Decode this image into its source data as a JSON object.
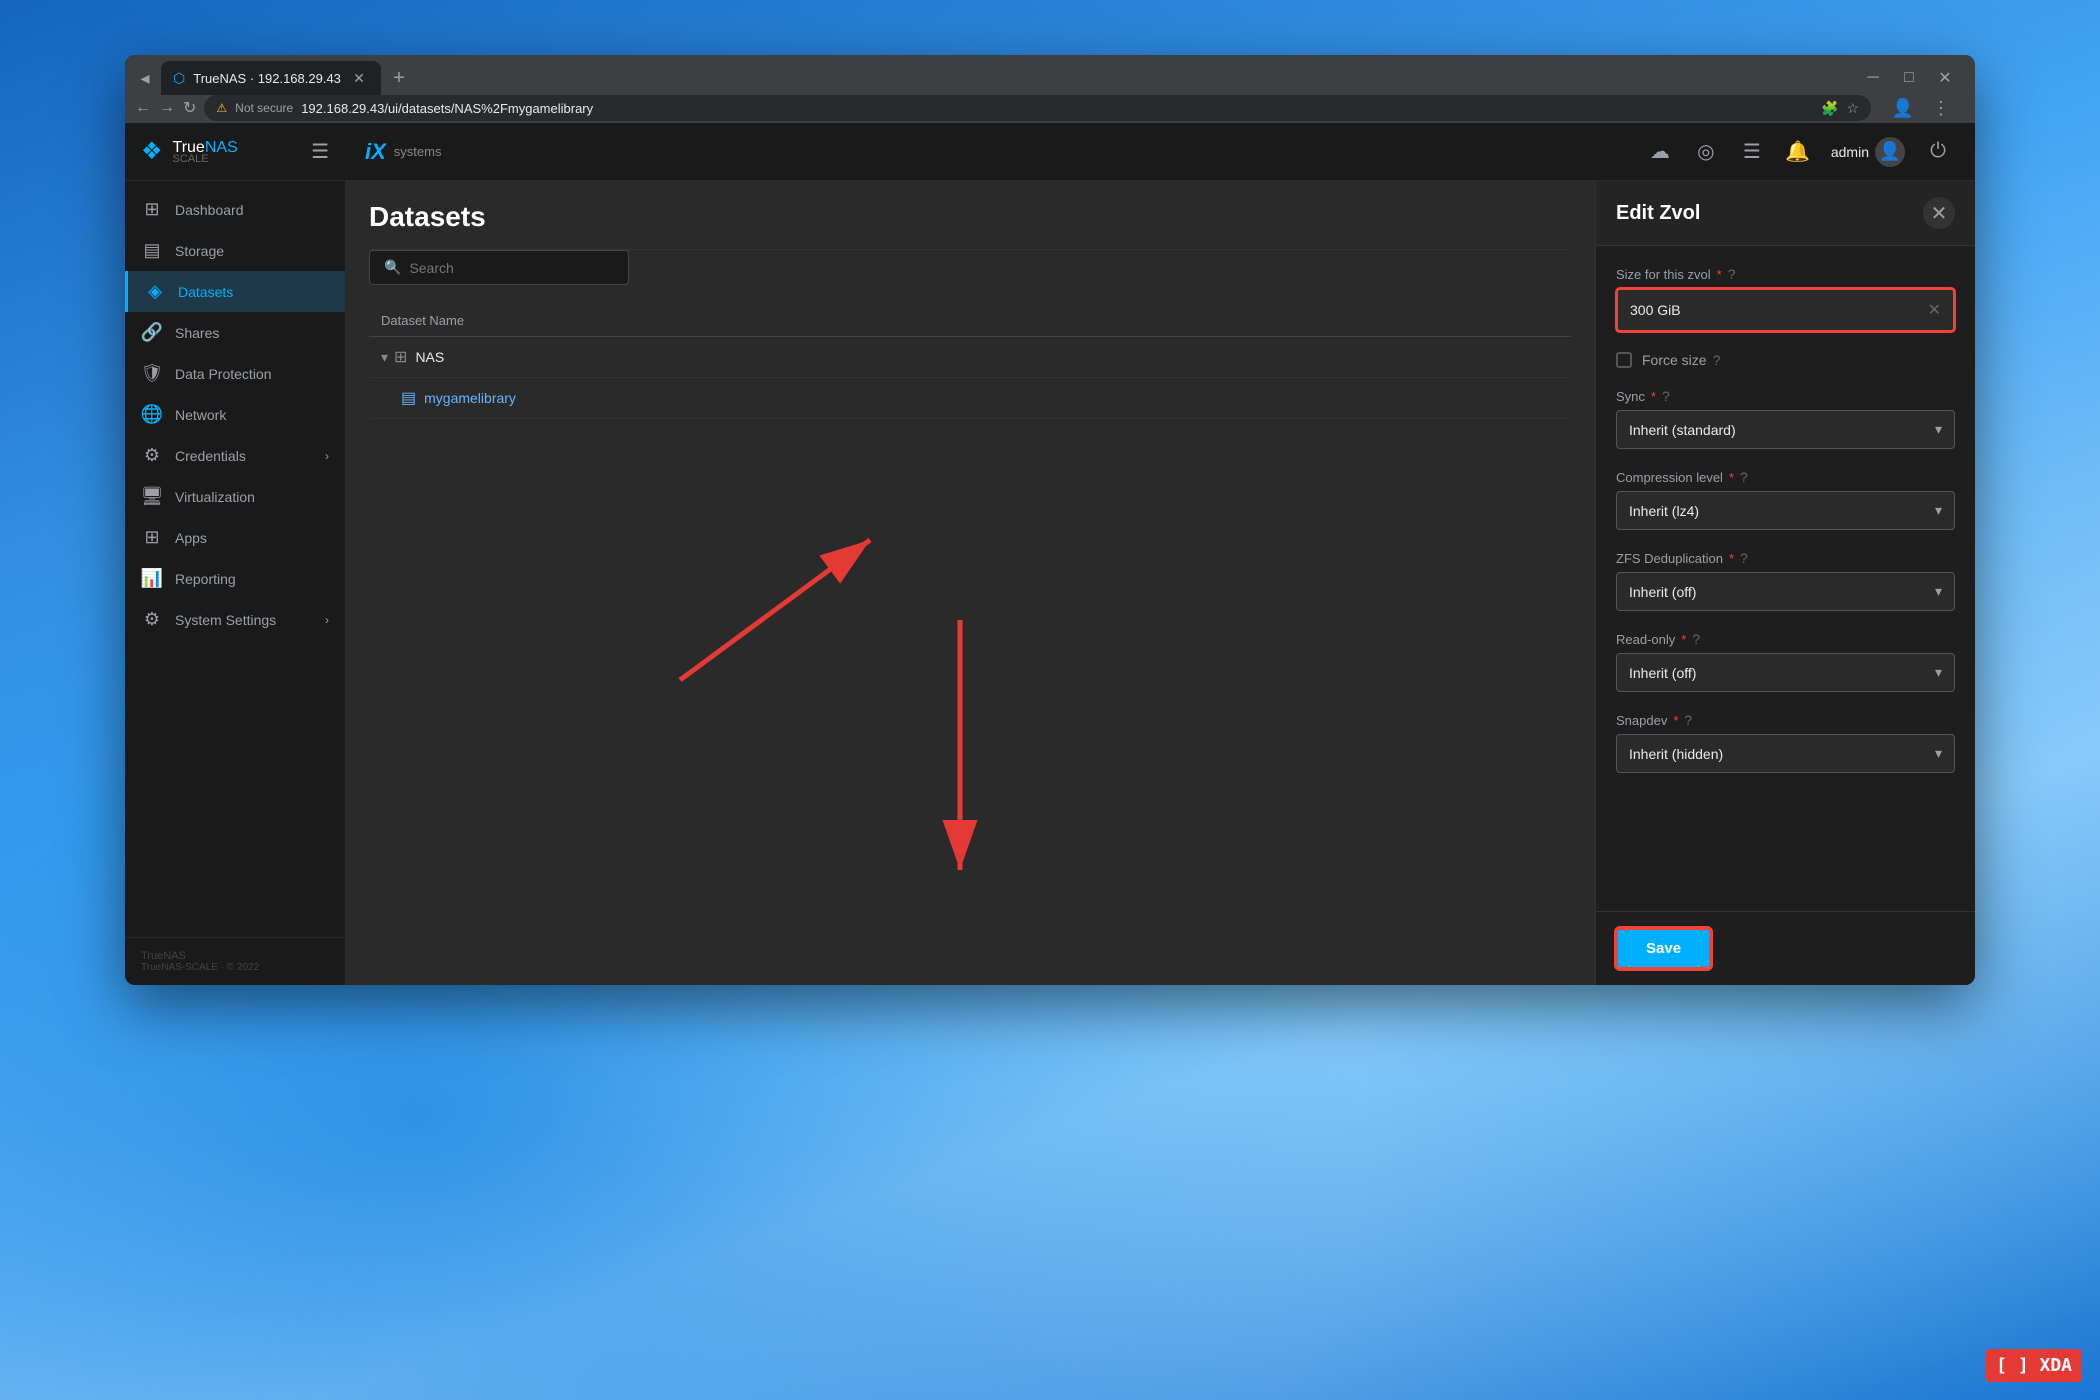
{
  "desktop": {
    "xda_logo": "[ ] XDA"
  },
  "browser": {
    "tab": {
      "favicon": "⬡",
      "title": "TrueNAS · 192.168.29.43",
      "close": "✕"
    },
    "new_tab": "+",
    "window_controls": {
      "minimize": "─",
      "maximize": "□",
      "close": "✕"
    },
    "address_bar": {
      "back": "←",
      "forward": "→",
      "reload": "↻",
      "security_icon": "⚠",
      "security_text": "Not secure",
      "url": "192.168.29.43/ui/datasets/NAS%2Fmygamelibrary",
      "extensions_icon": "🧩",
      "star_icon": "☆",
      "profile_icon": "👤",
      "menu_icon": "⋮"
    }
  },
  "truenas": {
    "logo": {
      "icon": "❖",
      "true": "True",
      "nas": "NAS",
      "scale": "SCALE"
    },
    "topbar": {
      "ix_logo": "iX",
      "ix_text": "systems",
      "icons": [
        "☁",
        "◎",
        "☰",
        "🔔"
      ],
      "user": "admin",
      "user_icon": "👤",
      "power_icon": "⏻"
    },
    "sidebar": {
      "hamburger": "☰",
      "items": [
        {
          "id": "dashboard",
          "icon": "⊞",
          "label": "Dashboard",
          "active": false
        },
        {
          "id": "storage",
          "icon": "🗄",
          "label": "Storage",
          "active": false
        },
        {
          "id": "datasets",
          "icon": "◈",
          "label": "Datasets",
          "active": true
        },
        {
          "id": "shares",
          "icon": "🔗",
          "label": "Shares",
          "active": false
        },
        {
          "id": "data-protection",
          "icon": "🛡",
          "label": "Data Protection",
          "active": false
        },
        {
          "id": "network",
          "icon": "🌐",
          "label": "Network",
          "active": false
        },
        {
          "id": "credentials",
          "icon": "⚙",
          "label": "Credentials",
          "active": false,
          "has_chevron": true
        },
        {
          "id": "virtualization",
          "icon": "🖥",
          "label": "Virtualization",
          "active": false
        },
        {
          "id": "apps",
          "icon": "⊞",
          "label": "Apps",
          "active": false
        },
        {
          "id": "reporting",
          "icon": "📊",
          "label": "Reporting",
          "active": false
        },
        {
          "id": "system-settings",
          "icon": "⚙",
          "label": "System Settings",
          "active": false,
          "has_chevron": true
        }
      ],
      "footer": {
        "version": "TrueNAS-SCALE · © 2022"
      }
    },
    "main": {
      "title": "Datasets",
      "search_placeholder": "Search",
      "table": {
        "header": "Dataset Name",
        "rows": [
          {
            "name": "NAS",
            "icon": "⊞",
            "expand": true,
            "level": 0
          },
          {
            "name": "mygamelibrary",
            "icon": "🗄",
            "expand": false,
            "level": 1,
            "type": "zvol"
          }
        ]
      }
    },
    "edit_zvol": {
      "title": "Edit Zvol",
      "close_btn": "✕",
      "fields": {
        "size": {
          "label": "Size for this zvol",
          "required": true,
          "help": true,
          "value": "300 GiB",
          "highlighted": true
        },
        "force_size": {
          "label": "Force size",
          "help": true,
          "checked": false
        },
        "sync": {
          "label": "Sync",
          "required": true,
          "help": true,
          "value": "Inherit (standard)"
        },
        "compression_level": {
          "label": "Compression level",
          "required": true,
          "help": true,
          "value": "Inherit (lz4)"
        },
        "zfs_deduplication": {
          "label": "ZFS Deduplication",
          "required": true,
          "help": true,
          "value": "Inherit (off)"
        },
        "read_only": {
          "label": "Read-only",
          "required": true,
          "help": true,
          "value": "Inherit (off)",
          "highlighted": true
        },
        "snapdev": {
          "label": "Snapdev",
          "required": true,
          "help": true,
          "value": "Inherit (hidden)"
        }
      },
      "save_button": "Save"
    }
  }
}
